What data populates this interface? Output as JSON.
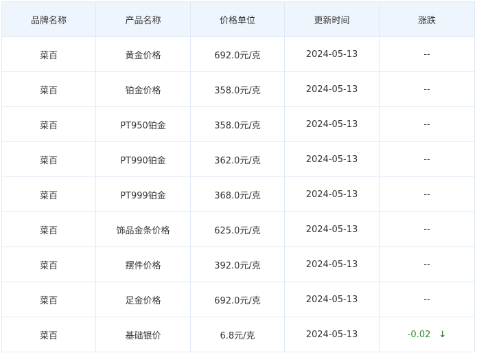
{
  "table": {
    "headers": [
      "品牌名称",
      "产品名称",
      "价格单位",
      "更新时间",
      "涨跌"
    ],
    "rows": [
      {
        "brand": "菜百",
        "product": "黄金价格",
        "price": "692.0元/克",
        "date": "2024-05-13",
        "change": "--"
      },
      {
        "brand": "菜百",
        "product": "铂金价格",
        "price": "358.0元/克",
        "date": "2024-05-13",
        "change": "--"
      },
      {
        "brand": "菜百",
        "product": "PT950铂金",
        "price": "358.0元/克",
        "date": "2024-05-13",
        "change": "--"
      },
      {
        "brand": "菜百",
        "product": "PT990铂金",
        "price": "362.0元/克",
        "date": "2024-05-13",
        "change": "--"
      },
      {
        "brand": "菜百",
        "product": "PT999铂金",
        "price": "368.0元/克",
        "date": "2024-05-13",
        "change": "--"
      },
      {
        "brand": "菜百",
        "product": "饰品金条价格",
        "price": "625.0元/克",
        "date": "2024-05-13",
        "change": "--"
      },
      {
        "brand": "菜百",
        "product": "摆件价格",
        "price": "392.0元/克",
        "date": "2024-05-13",
        "change": "--"
      },
      {
        "brand": "菜百",
        "product": "足金价格",
        "price": "692.0元/克",
        "date": "2024-05-13",
        "change": "--"
      },
      {
        "brand": "菜百",
        "product": "基础银价",
        "price": "6.8元/克",
        "date": "2024-05-13",
        "change": "-0.02",
        "change_icon": "arrow-down-icon",
        "change_color": "#2e8b2e"
      }
    ]
  }
}
